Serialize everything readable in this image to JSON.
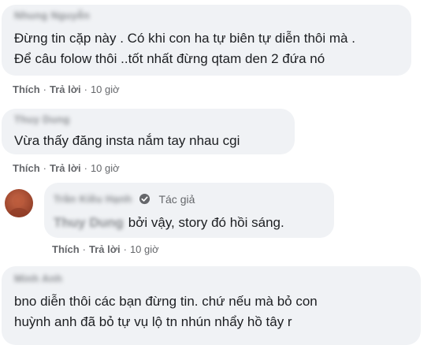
{
  "comments": [
    {
      "author": "Nhung Nguyễn",
      "lines": [
        "Đừng tin cặp này . Có khi con ha tự biên tự diễn thôi mà .",
        "Để câu folow thôi ..tốt nhất đừng qtam den 2 đứa nó"
      ],
      "like": "Thích",
      "reply": "Trả lời",
      "time": "10 giờ"
    },
    {
      "author": "Thuy Dung",
      "lines": [
        "Vừa thấy đăng insta nắm tay nhau cgi"
      ],
      "like": "Thích",
      "reply": "Trả lời",
      "time": "10 giờ"
    },
    {
      "author": "Trần Kiều Hạnh",
      "badge": "Tác giả",
      "mention": "Thuy Dung",
      "text": "bởi vậy, story đó hồi sáng.",
      "like": "Thích",
      "reply": "Trả lời",
      "time": "10 giờ"
    },
    {
      "author": "Minh Anh",
      "lines": [
        "bno diễn thôi các bạn đừng tin. chứ nếu mà bỏ con",
        "huỳnh anh đã bỏ tự vụ lộ tn nhún nhẩy hồ tây r"
      ]
    }
  ],
  "dot": "·",
  "colors": {
    "bubble": "#f0f2f5",
    "meta": "#65676b",
    "verified": "#65676b"
  },
  "icons": {
    "verified": "check-badge-icon"
  }
}
